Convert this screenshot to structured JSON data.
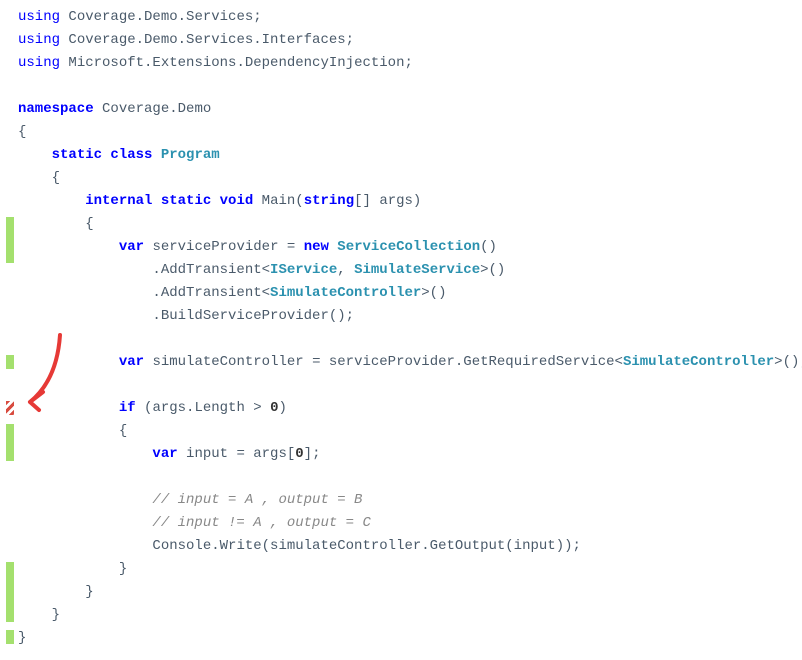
{
  "code": {
    "using1_kw": "using",
    "using1_ns": " Coverage.Demo.Services;",
    "using2_kw": "using",
    "using2_ns": " Coverage.Demo.Services.Interfaces;",
    "using3_kw": "using",
    "using3_ns": " Microsoft.Extensions.DependencyInjection;",
    "ns_kw": "namespace",
    "ns_name": " Coverage.Demo",
    "brace_open": "{",
    "brace_close": "}",
    "indent1": "    ",
    "indent2": "        ",
    "indent3": "            ",
    "indent4": "                ",
    "class_static": "static",
    "class_class": " class",
    "class_name": " Program",
    "main_internal": "internal",
    "main_static": " static",
    "main_void": " void",
    "main_name": " Main(",
    "main_string": "string",
    "main_args": "[] args)",
    "var_kw": "var",
    "sp_name": " serviceProvider = ",
    "new_kw": "new",
    "sc_type": " ServiceCollection",
    "sc_paren": "()",
    "addtrans1_pre": ".AddTransient<",
    "iservice": "IService",
    "comma": ", ",
    "simservice": "SimulateService",
    "gt_paren": ">()",
    "addtrans2_pre": ".AddTransient<",
    "simcontroller": "SimulateController",
    "build_pre": ".BuildServiceProvider();",
    "simctrl_name": " simulateController = serviceProvider.GetRequiredService<",
    "simctrl_end": ">();",
    "if_kw": "if",
    "if_cond": " (args.Length > ",
    "zero": "0",
    "if_close": ")",
    "input_name": " input = args[",
    "input_close": "];",
    "comment1": "// input = A , output = B",
    "comment2": "// input != A , output = C",
    "console_pre": "Console",
    "console_write": ".Write(simulateController.GetOutput(input));"
  },
  "coverage": {
    "covered_color": "#a4e06e",
    "partial_color": "#d84b3f"
  }
}
